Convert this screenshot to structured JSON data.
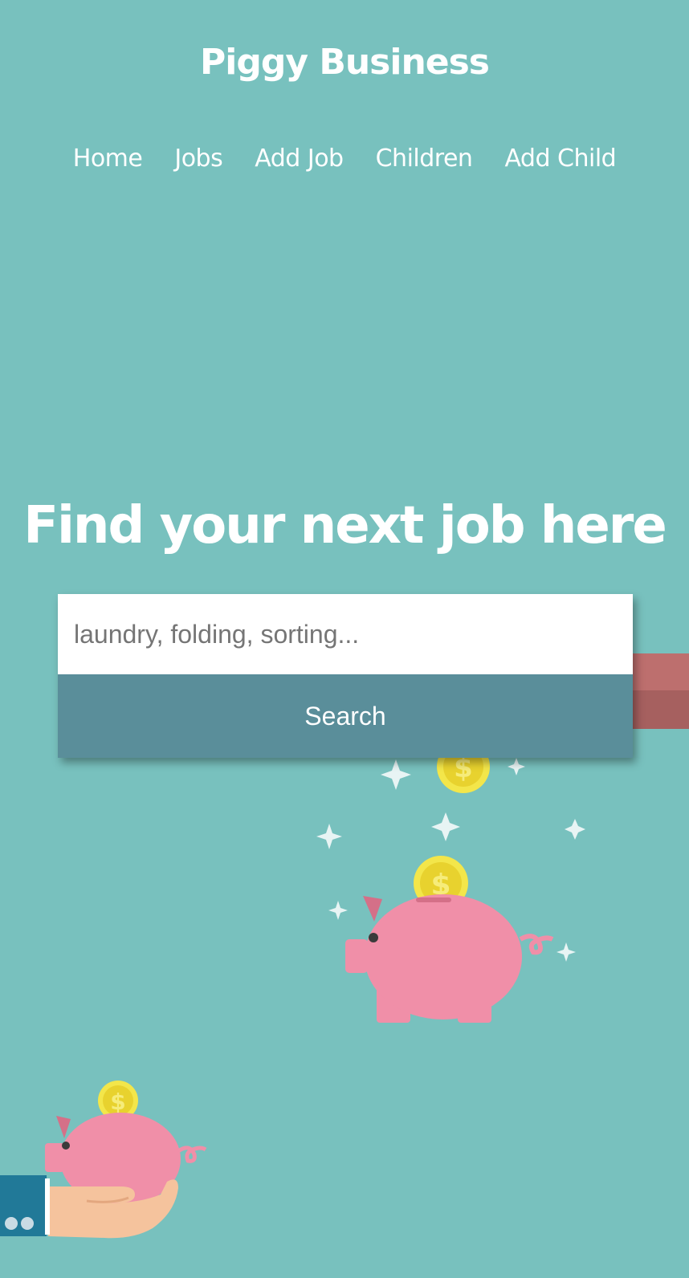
{
  "header": {
    "title": "Piggy Business"
  },
  "nav": {
    "items": [
      {
        "label": "Home"
      },
      {
        "label": "Jobs"
      },
      {
        "label": "Add Job"
      },
      {
        "label": "Children"
      },
      {
        "label": "Add Child"
      }
    ]
  },
  "hero": {
    "heading": "Find your next job here"
  },
  "search": {
    "placeholder": "laundry, folding, sorting...",
    "value": "",
    "button_label": "Search"
  },
  "icons": {
    "coin": "dollar-coin-icon",
    "pig": "piggy-bank-icon",
    "sparkle": "sparkle-icon",
    "hand": "hand-icon"
  },
  "colors": {
    "background": "#78c1be",
    "button": "#5a8e9a",
    "pig": "#f08fa8",
    "coin": "#f0e040"
  }
}
